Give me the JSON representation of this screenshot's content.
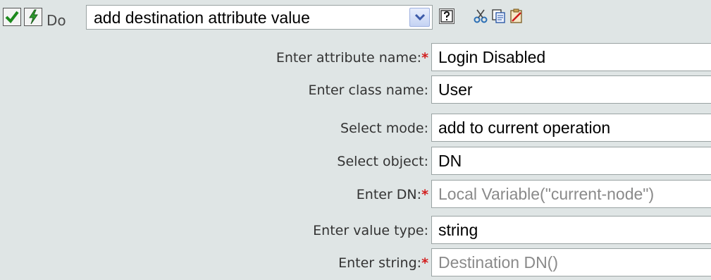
{
  "toolbar": {
    "do_label": "Do",
    "action_value": "add destination attribute value",
    "icons": [
      "enabled-check-icon",
      "toggle-bolt-icon",
      "help-icon",
      "cut-icon",
      "copy-icon",
      "paste-icon"
    ]
  },
  "form": {
    "rows": [
      {
        "label": "Enter attribute name:",
        "required": "*",
        "value": "Login Disabled",
        "placeholder": false
      },
      {
        "label": "Enter class name:",
        "required": "",
        "value": "User",
        "placeholder": false
      },
      {
        "label": "Select mode:",
        "required": "",
        "value": "add to current operation",
        "placeholder": false
      },
      {
        "label": "Select object:",
        "required": "",
        "value": "DN",
        "placeholder": false
      },
      {
        "label": "Enter DN:",
        "required": "*",
        "value": "Local Variable(\"current-node\")",
        "placeholder": true
      },
      {
        "label": "Enter value type:",
        "required": "",
        "value": "string",
        "placeholder": false
      },
      {
        "label": "Enter string:",
        "required": "*",
        "value": "Destination DN()",
        "placeholder": true
      }
    ]
  },
  "colors": {
    "panel_bg": "#dfe5e5",
    "required_marker": "#d21d1d",
    "placeholder_text": "#8a8a8a"
  }
}
